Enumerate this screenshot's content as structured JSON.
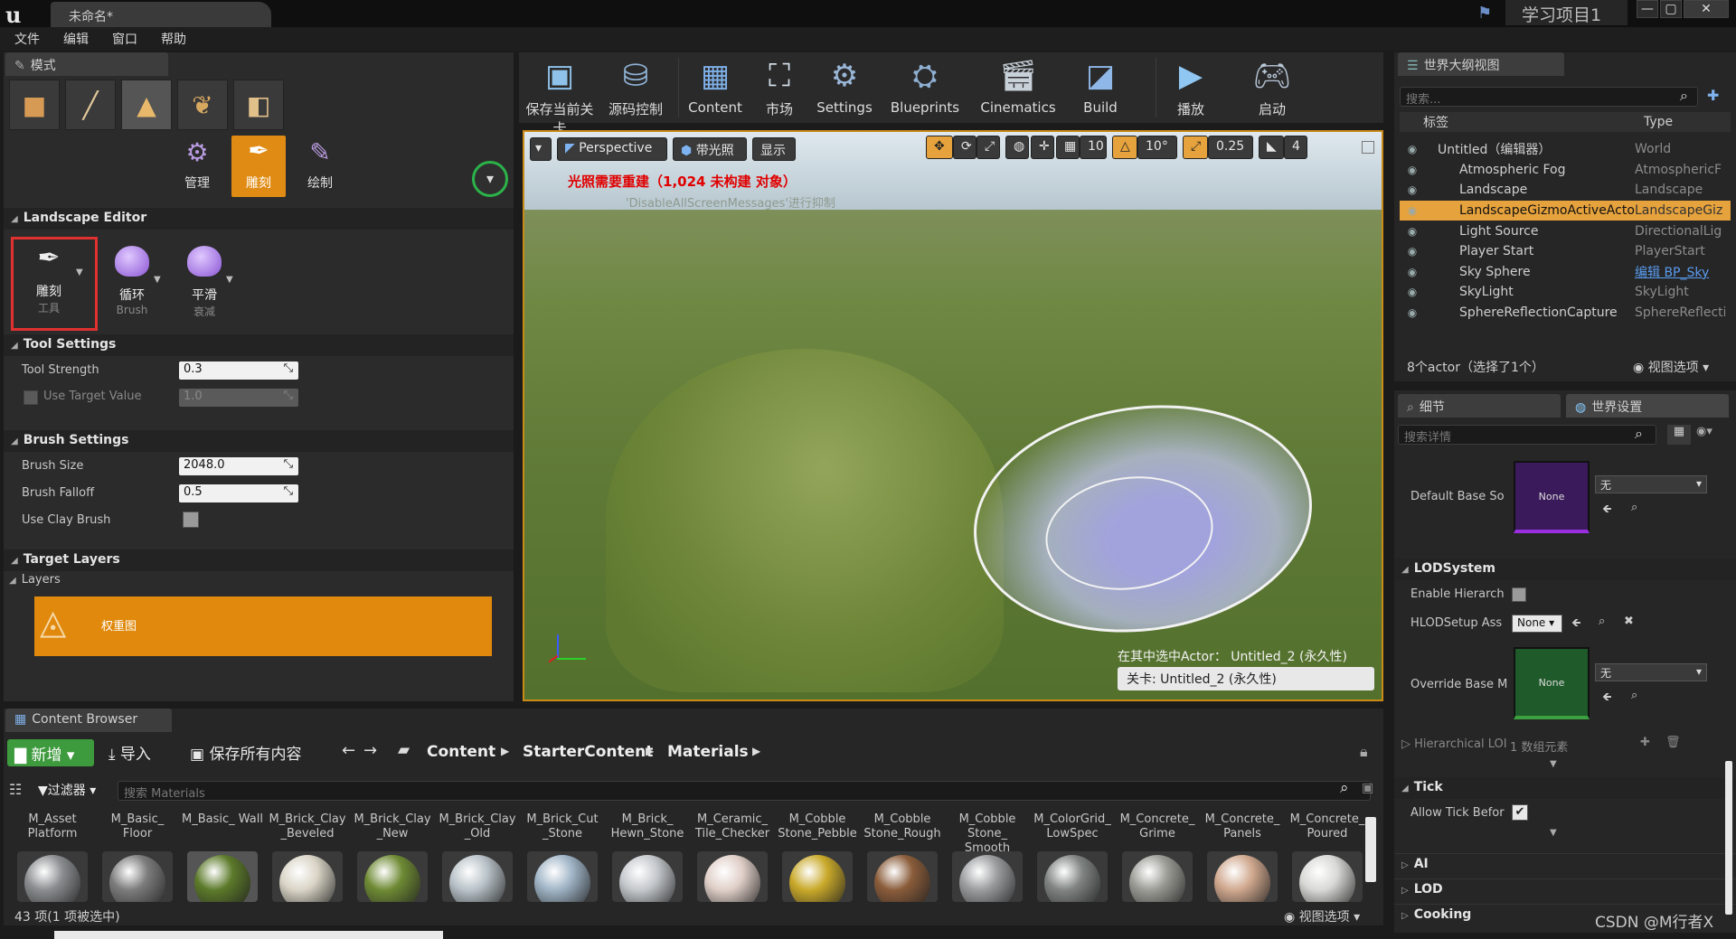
{
  "window": {
    "doc_tab": "未命名*",
    "project": "学习项目1",
    "min": "—",
    "max": "▢",
    "close": "✕"
  },
  "menu": [
    "文件",
    "编辑",
    "窗口",
    "帮助"
  ],
  "modes": {
    "tab": "模式",
    "sub_labels": [
      "管理",
      "雕刻",
      "绘制"
    ]
  },
  "landscape": {
    "section_title": "Landscape Editor",
    "tools": [
      {
        "label": "雕刻",
        "sub": "工具"
      },
      {
        "label": "循环",
        "sub": "Brush"
      },
      {
        "label": "平滑",
        "sub": "衰减"
      }
    ]
  },
  "tool_settings": {
    "title": "Tool Settings",
    "strength_label": "Tool Strength",
    "strength_value": "0.3",
    "target_label": "Use Target Value",
    "target_value": "1.0"
  },
  "brush_settings": {
    "title": "Brush Settings",
    "size_label": "Brush Size",
    "size_value": "2048.0",
    "falloff_label": "Brush Falloff",
    "falloff_value": "0.5",
    "clay_label": "Use Clay Brush"
  },
  "target_layers": {
    "title": "Target Layers",
    "layers_label": "Layers",
    "layer_name": "权重图"
  },
  "toolbar": {
    "items": [
      "保存当前关卡",
      "源码控制",
      "Content",
      "市场",
      "Settings",
      "Blueprints",
      "Cinematics",
      "Build",
      "播放",
      "启动"
    ]
  },
  "viewport": {
    "perspective": "Perspective",
    "lit": "带光照",
    "show": "显示",
    "grid_value": "10",
    "rot_value": "10°",
    "scale_value": "0.25",
    "cam_value": "4",
    "warning": "光照需要重建（1,024 未构建 对象）",
    "suppressed": "'DisableAllScreenMessages'进行抑制",
    "selected_actor": "在其中选中Actor：  Untitled_2 (永久性)",
    "level": "关卡:  Untitled_2 (永久性)"
  },
  "outliner": {
    "tab": "世界大纲视图",
    "search_placeholder": "搜索...",
    "col_label": "标签",
    "col_type": "Type",
    "rows": [
      {
        "name": "Untitled（编辑器）",
        "type": "World"
      },
      {
        "name": "Atmospheric Fog",
        "type": "AtmosphericF"
      },
      {
        "name": "Landscape",
        "type": "Landscape"
      },
      {
        "name": "LandscapeGizmoActiveActor",
        "type": "LandscapeGiz"
      },
      {
        "name": "Light Source",
        "type": "DirectionalLig"
      },
      {
        "name": "Player Start",
        "type": "PlayerStart"
      },
      {
        "name": "Sky Sphere",
        "type": "编辑 BP_Sky"
      },
      {
        "name": "SkyLight",
        "type": "SkyLight"
      },
      {
        "name": "SphereReflectionCapture",
        "type": "SphereReflecti"
      }
    ],
    "footer": "8个actor（选择了1个）",
    "view_options": "视图选项"
  },
  "details": {
    "tab1": "细节",
    "tab2": "世界设置",
    "search_placeholder": "搜索详情",
    "default_base": "Default Base So",
    "none": "None",
    "wu": "无",
    "lod_title": "LODSystem",
    "enable_hier": "Enable Hierarch",
    "hlod_setup": "HLODSetup Ass",
    "override_base": "Override Base M",
    "hier_lod": "Hierarchical LOI",
    "array_elems": "1 数组元素",
    "tick_title": "Tick",
    "allow_tick": "Allow Tick Befor",
    "ai": "AI",
    "lod": "LOD",
    "cooking": "Cooking"
  },
  "content_browser": {
    "tab": "Content Browser",
    "add_new": "新增",
    "import": "导入",
    "save_all": "保存所有内容",
    "path": [
      "Content",
      "StarterContent",
      "Materials"
    ],
    "filters": "过滤器",
    "search_placeholder": "搜索 Materials",
    "assets": [
      {
        "name": "M_Asset Platform",
        "color": "#8a8d8f"
      },
      {
        "name": "M_Basic_ Floor",
        "color": "#7c7c7c"
      },
      {
        "name": "M_Basic_ Wall",
        "color": "#5c7a2a"
      },
      {
        "name": "M_Brick_Clay _Beveled",
        "color": "#d9d4c6"
      },
      {
        "name": "M_Brick_Clay _New",
        "color": "#6e8a34"
      },
      {
        "name": "M_Brick_Clay _Old",
        "color": "#b8c2c8"
      },
      {
        "name": "M_Brick_Cut _Stone",
        "color": "#9fb4c6"
      },
      {
        "name": "M_Brick_ Hewn_Stone",
        "color": "#c4c8cc"
      },
      {
        "name": "M_Ceramic_ Tile_Checker",
        "color": "#e0cfc8"
      },
      {
        "name": "M_Cobble Stone_Pebble",
        "color": "#c9a92a"
      },
      {
        "name": "M_Cobble Stone_Rough",
        "color": "#8a5c3a"
      },
      {
        "name": "M_Cobble Stone_ Smooth",
        "color": "#9a9c9e"
      },
      {
        "name": "M_ColorGrid_ LowSpec",
        "color": "#7f8382"
      },
      {
        "name": "M_Concrete_ Grime",
        "color": "#9c9c96"
      },
      {
        "name": "M_Concrete_ Panels",
        "color": "#d0a88e"
      },
      {
        "name": "M_Concrete_ Poured",
        "color": "#d8d8d6"
      }
    ],
    "status": "43 项(1 项被选中)",
    "view_options": "视图选项"
  },
  "watermark": "CSDN @M行者X"
}
